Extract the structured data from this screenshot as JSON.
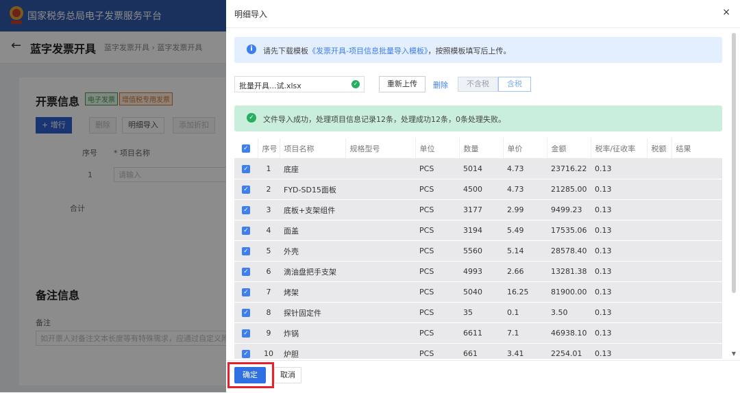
{
  "app": {
    "title": "国家税务总局电子发票服务平台"
  },
  "page": {
    "title": "蓝字发票开具",
    "breadcrumb": "蓝字发票开具 › 蓝字发票开具",
    "invoice_section": "开票信息",
    "tag_electronic": "电子发票",
    "tag_vat": "增值税专用发票",
    "btn_add_row": "+ 增行",
    "btn_delete": "删除",
    "btn_detail_import": "明细导入",
    "btn_add_discount": "添加折扣",
    "col_no": "序号",
    "col_item": "* 项目名称",
    "row_no": "1",
    "input_placeholder": "请输入",
    "total_label": "合计",
    "remark_section": "备注信息",
    "remark_label": "备注",
    "remark_placeholder": "如开票人对备注文本长度等有特殊需求，应通过自定义附"
  },
  "drawer": {
    "title": "明细导入",
    "close": "×",
    "info_prefix": "请先下载模板",
    "info_link": "《发票开具-项目信息批量导入模板》",
    "info_suffix": "，按照模板填写后上传。",
    "file_name": "批量开具...试.xlsx",
    "reupload": "重新上传",
    "delete": "删除",
    "tax_excluded": "不含税",
    "tax_included": "含税",
    "success_text": "文件导入成功，处理项目信息记录12条，处理成功12条，0条处理失败。",
    "confirm": "确定",
    "cancel": "取消"
  },
  "table": {
    "headers": [
      "序号",
      "项目名称",
      "规格型号",
      "单位",
      "数量",
      "单价",
      "金额",
      "税率/征收率",
      "税额",
      "结果"
    ],
    "rows": [
      {
        "no": "1",
        "name": "底座",
        "spec": "",
        "unit": "PCS",
        "qty": "5014",
        "price": "4.73",
        "amount": "23716.22",
        "rate": "0.13"
      },
      {
        "no": "2",
        "name": "FYD-SD15面板",
        "spec": "",
        "unit": "PCS",
        "qty": "4500",
        "price": "4.73",
        "amount": "21285.00",
        "rate": "0.13"
      },
      {
        "no": "3",
        "name": "底板+支架组件",
        "spec": "",
        "unit": "PCS",
        "qty": "3177",
        "price": "2.99",
        "amount": "9499.23",
        "rate": "0.13"
      },
      {
        "no": "4",
        "name": "面盖",
        "spec": "",
        "unit": "PCS",
        "qty": "3194",
        "price": "5.49",
        "amount": "17535.06",
        "rate": "0.13"
      },
      {
        "no": "5",
        "name": "外壳",
        "spec": "",
        "unit": "PCS",
        "qty": "5560",
        "price": "5.14",
        "amount": "28578.40",
        "rate": "0.13"
      },
      {
        "no": "6",
        "name": "滴油盘把手支架",
        "spec": "",
        "unit": "PCS",
        "qty": "4993",
        "price": "2.66",
        "amount": "13281.38",
        "rate": "0.13"
      },
      {
        "no": "7",
        "name": "烤架",
        "spec": "",
        "unit": "PCS",
        "qty": "5040",
        "price": "16.25",
        "amount": "81900.00",
        "rate": "0.13"
      },
      {
        "no": "8",
        "name": "探针固定件",
        "spec": "",
        "unit": "PCS",
        "qty": "35",
        "price": "0.1",
        "amount": "3.50",
        "rate": "0.13"
      },
      {
        "no": "9",
        "name": "炸锅",
        "spec": "",
        "unit": "PCS",
        "qty": "6611",
        "price": "7.1",
        "amount": "46938.10",
        "rate": "0.13"
      },
      {
        "no": "10",
        "name": "炉胆",
        "spec": "",
        "unit": "PCS",
        "qty": "661",
        "price": "3.41",
        "amount": "2254.01",
        "rate": "0.13"
      }
    ]
  },
  "colors": {
    "primary": "#2f6fe4",
    "highlight": "#e8202a",
    "success_bg": "#c9eedb",
    "info_bg": "#e3efff"
  }
}
